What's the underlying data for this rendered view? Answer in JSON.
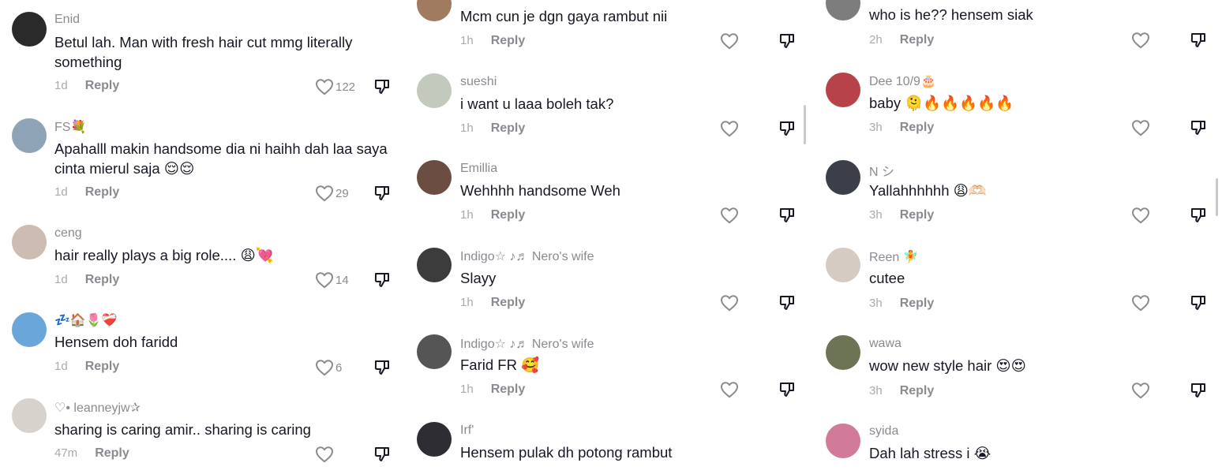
{
  "reply_label": "Reply",
  "columns": [
    {
      "comments": [
        {
          "user": "Enid",
          "text": "Betul lah. Man with fresh hair cut mmg literally something",
          "time": "1d",
          "likes": "122",
          "avatar": "#2a2a2a"
        },
        {
          "user": "FS💐",
          "text": "Apahalll makin handsome dia ni haihh dah laa saya cinta mierul saja 😌😌",
          "time": "1d",
          "likes": "29",
          "avatar": "#8fa3b7"
        },
        {
          "user": "ceng",
          "text": "hair really plays a big role.... 😩💘",
          "time": "1d",
          "likes": "14",
          "avatar": "#cdbcb1"
        },
        {
          "user": "💤🏠🌷❤️‍🩹",
          "text": "Hensem doh faridd",
          "time": "1d",
          "likes": "6",
          "avatar": "#6aa6d9"
        },
        {
          "user": "♡• leanneyjw✰",
          "text": "sharing is caring amir.. sharing is caring",
          "time": "47m",
          "likes": "",
          "avatar": "#d8d2cc"
        }
      ]
    },
    {
      "comments": [
        {
          "user": "",
          "text": "Mcm cun je dgn gaya rambut nii",
          "time": "1h",
          "likes": "",
          "avatar": "#a07b5f"
        },
        {
          "user": "sueshi",
          "text": "i want u laaa boleh tak?",
          "time": "1h",
          "likes": "",
          "avatar": "#c2c9bd"
        },
        {
          "user": "Emillia",
          "text": "Wehhhh handsome Weh",
          "time": "1h",
          "likes": "",
          "avatar": "#6b4e41"
        },
        {
          "user": "Indigo☆ ♪♬ Nero's wife",
          "text": "Slayy",
          "time": "1h",
          "likes": "",
          "avatar": "#3c3c3c"
        },
        {
          "user": "Indigo☆ ♪♬ Nero's wife",
          "text": "Farid FR 🥰",
          "time": "1h",
          "likes": "",
          "avatar": "#555555"
        },
        {
          "user": "Irf'",
          "text": "Hensem pulak dh potong rambut",
          "time": "",
          "likes": "",
          "avatar": "#2d2d33"
        }
      ]
    },
    {
      "comments": [
        {
          "user": "",
          "text": "who is he?? hensem siak",
          "time": "2h",
          "likes": "",
          "avatar": "#7d7d7d"
        },
        {
          "user": "Dee 10/9🎂",
          "text": "baby 🫠🔥🔥🔥🔥🔥",
          "time": "3h",
          "likes": "",
          "avatar": "#b8424a"
        },
        {
          "user": "N シ",
          "text": "Yallahhhhhh 😩🫶🏻",
          "time": "3h",
          "likes": "",
          "avatar": "#3a3f4a"
        },
        {
          "user": "Reen 🧚",
          "text": "cutee",
          "time": "3h",
          "likes": "",
          "avatar": "#d6cbc3"
        },
        {
          "user": "wawa",
          "text": "wow new style hair 😍😍",
          "time": "3h",
          "likes": "",
          "avatar": "#6d7355"
        },
        {
          "user": "syida",
          "text": "Dah lah stress i 😭",
          "time": "",
          "likes": "",
          "avatar": "#d17a9a"
        }
      ]
    }
  ]
}
